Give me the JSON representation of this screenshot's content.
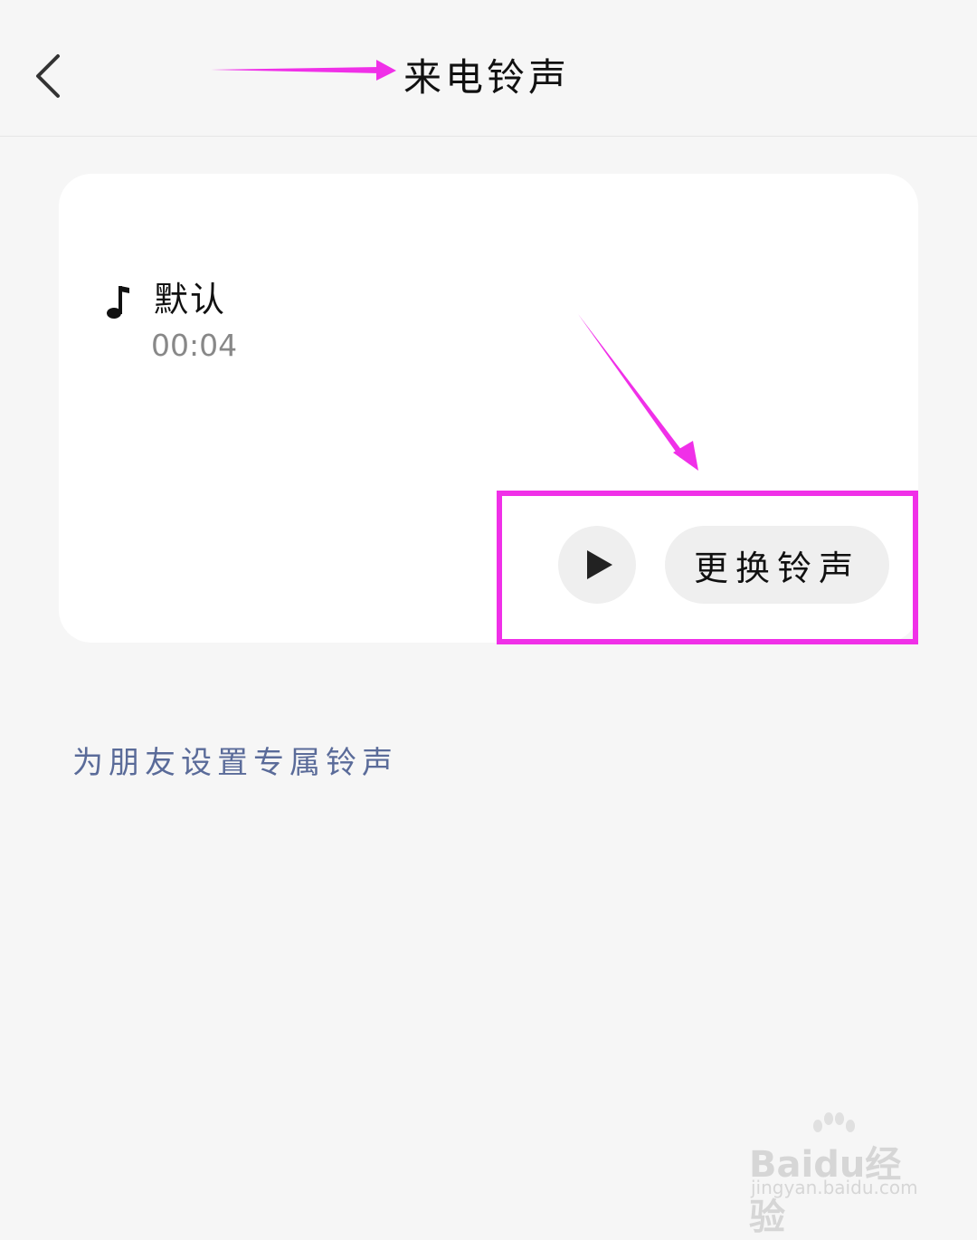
{
  "header": {
    "title": "来电铃声",
    "back_icon": "chevron-left-icon"
  },
  "ringtone": {
    "icon": "music-note-icon",
    "name": "默认",
    "duration": "00:04"
  },
  "actions": {
    "play_icon": "play-icon",
    "change_label": "更换铃声"
  },
  "friends_link": "为朋友设置专属铃声",
  "watermark": {
    "logo": "Baidu经验",
    "url": "jingyan.baidu.com"
  },
  "colors": {
    "annotation": "#f030e8",
    "link": "#5a6b99",
    "background": "#f6f6f6"
  }
}
